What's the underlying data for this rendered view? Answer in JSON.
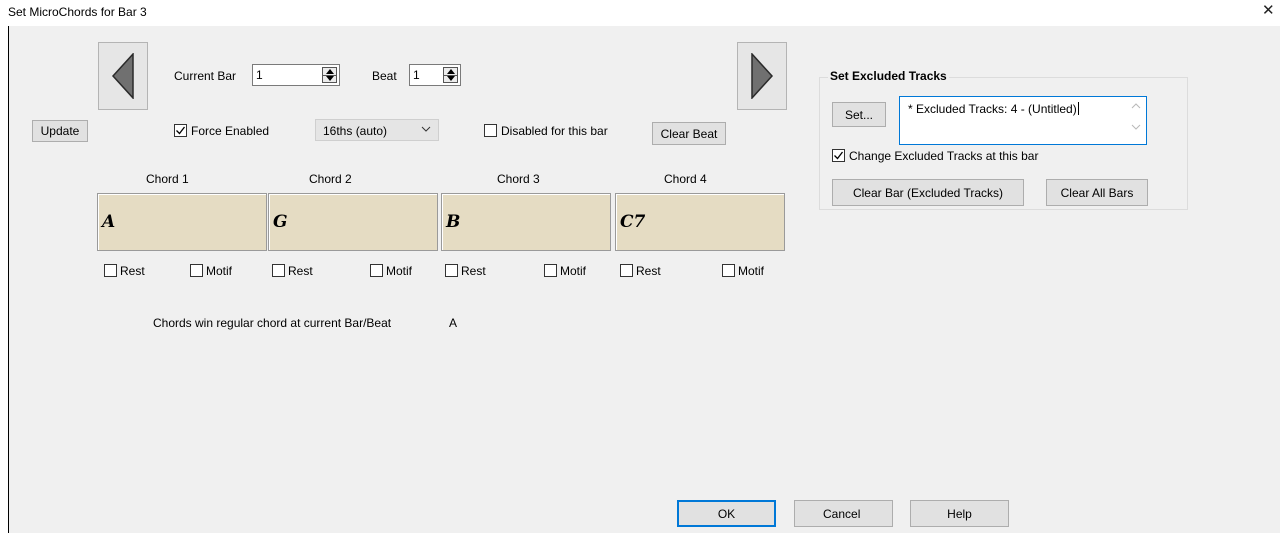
{
  "window": {
    "title": "Set MicroChords for Bar 3",
    "close_glyph": "✕"
  },
  "nav": {
    "prev_icon": "triangle-left-icon",
    "next_icon": "triangle-right-icon",
    "current_bar_label": "Current Bar",
    "current_bar_value": "1",
    "beat_label": "Beat",
    "beat_value": "1"
  },
  "toolbar": {
    "update_label": "Update",
    "force_enabled_label": "Force Enabled",
    "force_enabled_checked": true,
    "resolution_value": "16ths (auto)",
    "disabled_label": "Disabled for this bar",
    "disabled_checked": false,
    "clear_beat_label": "Clear Beat"
  },
  "chords": [
    {
      "header": "Chord 1",
      "symbol": "A",
      "rest_label": "Rest",
      "motif_label": "Motif",
      "rest_checked": false,
      "motif_checked": false
    },
    {
      "header": "Chord 2",
      "symbol": "G",
      "rest_label": "Rest",
      "motif_label": "Motif",
      "rest_checked": false,
      "motif_checked": false
    },
    {
      "header": "Chord 3",
      "symbol": "B",
      "rest_label": "Rest",
      "motif_label": "Motif",
      "rest_checked": false,
      "motif_checked": false
    },
    {
      "header": "Chord 4",
      "symbol": "C7",
      "rest_label": "Rest",
      "motif_label": "Motif",
      "rest_checked": false,
      "motif_checked": false
    }
  ],
  "info": {
    "text": "Chords win regular chord at current Bar/Beat",
    "value": "A"
  },
  "excluded": {
    "group_title": "Set Excluded Tracks",
    "set_label": "Set...",
    "textbox_value": "* Excluded Tracks: 4 - (Untitled)",
    "change_label": "Change Excluded Tracks at this bar",
    "change_checked": true,
    "clear_bar_label": "Clear Bar  (Excluded Tracks)",
    "clear_all_label": "Clear All Bars"
  },
  "footer": {
    "ok_label": "OK",
    "cancel_label": "Cancel",
    "help_label": "Help"
  },
  "colors": {
    "chord_box": "#e5dcc3",
    "default_button_border": "#0078d7",
    "dialog_background": "#f0f0f0"
  }
}
